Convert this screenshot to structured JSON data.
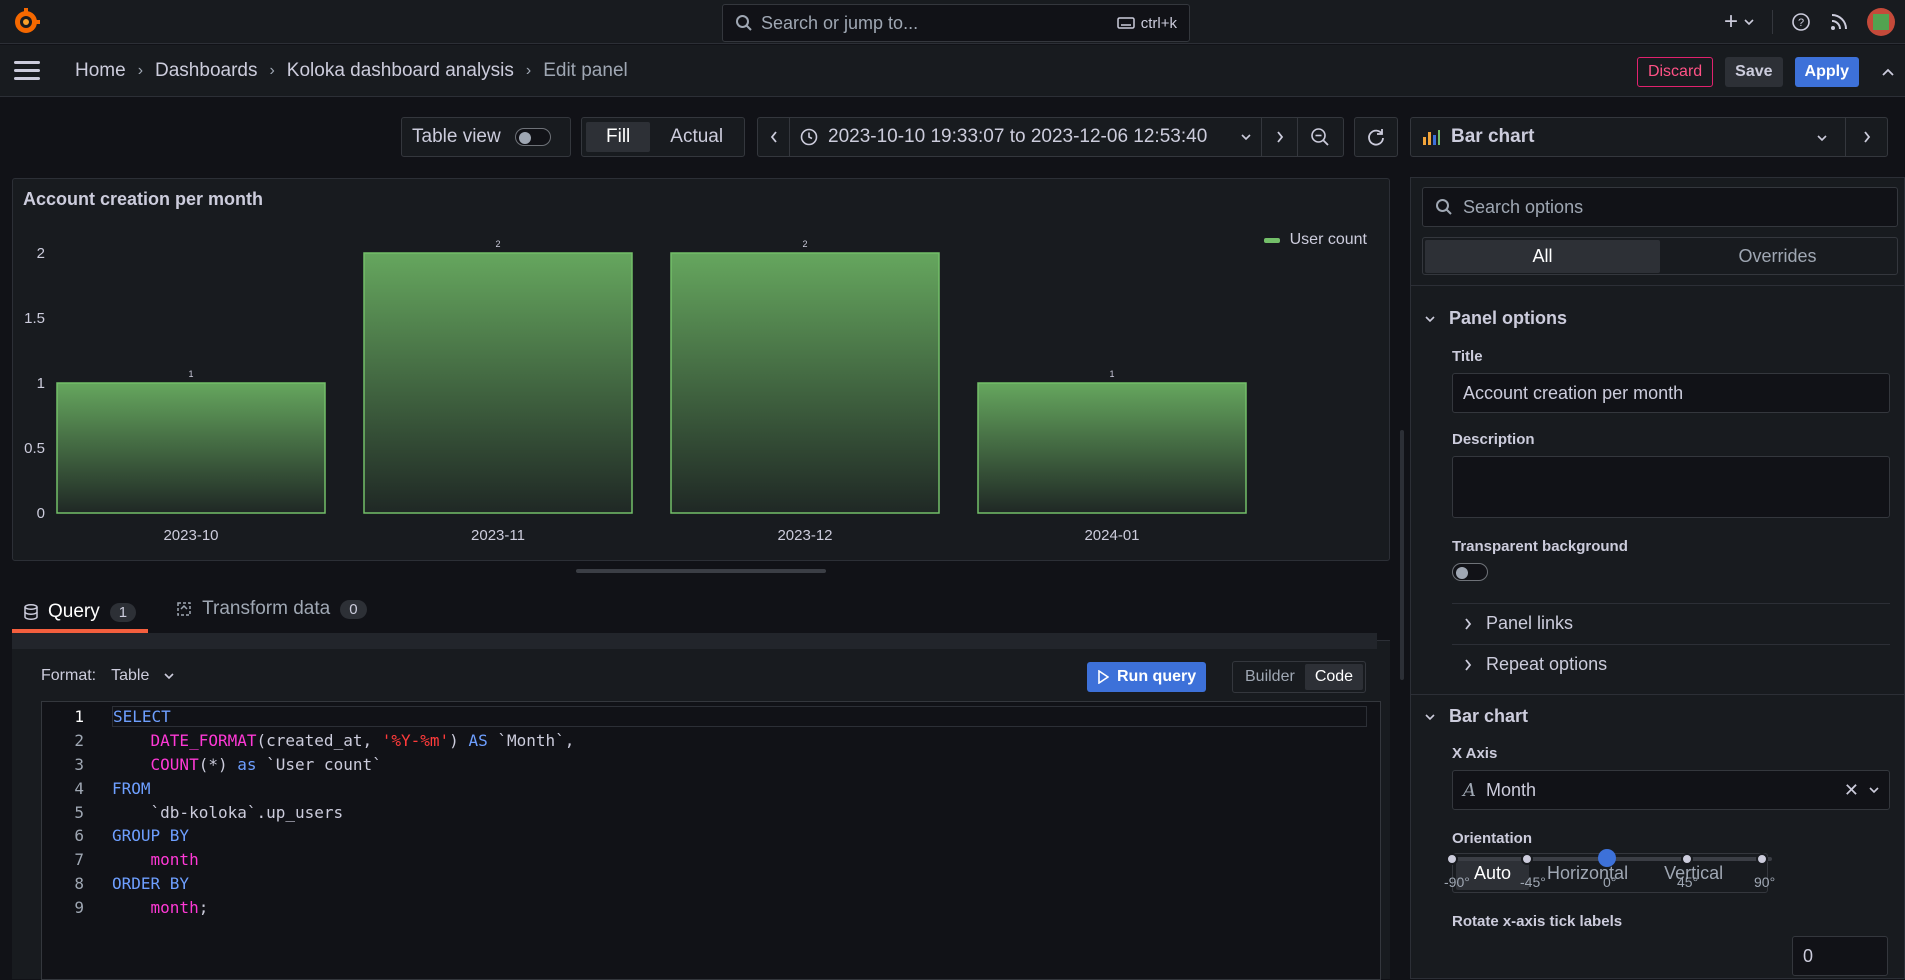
{
  "topbar": {
    "search_placeholder": "Search or jump to...",
    "search_shortcut": "ctrl+k",
    "plus_label": "+"
  },
  "breadcrumb": [
    "Home",
    "Dashboards",
    "Koloka dashboard analysis",
    "Edit panel"
  ],
  "actions": {
    "discard": "Discard",
    "save": "Save",
    "apply": "Apply"
  },
  "toolbar": {
    "table_view": "Table view",
    "fill": "Fill",
    "actual": "Actual",
    "time_range": "2023-10-10 19:33:07 to 2023-12-06 12:53:40"
  },
  "panel": {
    "title": "Account creation per month",
    "legend": "User count",
    "series_color": "#73bf69"
  },
  "chart_data": {
    "type": "bar",
    "categories": [
      "2023-10",
      "2023-11",
      "2023-12",
      "2024-01"
    ],
    "series": [
      {
        "name": "User count",
        "values": [
          1,
          2,
          2,
          1
        ]
      }
    ],
    "yticks": [
      "0",
      "0.5",
      "1",
      "1.5",
      "2"
    ],
    "ylim": [
      0,
      2
    ],
    "title": "Account creation per month",
    "legend_position": "top-right"
  },
  "query_tabs": [
    {
      "label": "Query",
      "count": "1"
    },
    {
      "label": "Transform data",
      "count": "0"
    }
  ],
  "query": {
    "format_label": "Format:",
    "format_value": "Table",
    "run_label": "Run query",
    "mode_builder": "Builder",
    "mode_code": "Code"
  },
  "code_lines": [
    {
      "n": "1",
      "html": "<span class=\"kw\">SELECT</span>"
    },
    {
      "n": "2",
      "html": "    <span class=\"fn\">DATE_FORMAT</span>(created_at, <span class=\"str\">'%Y-%m'</span>) <span class=\"kw\">AS</span> `Month`,"
    },
    {
      "n": "3",
      "html": "    <span class=\"fn\">COUNT</span>(*) <span class=\"kw\">as</span> `User count`"
    },
    {
      "n": "4",
      "html": "<span class=\"kw\">FROM</span>"
    },
    {
      "n": "5",
      "html": "    `db-koloka`.up_users"
    },
    {
      "n": "6",
      "html": "<span class=\"kw\">GROUP BY</span>"
    },
    {
      "n": "7",
      "html": "    <span class=\"fn\">month</span>"
    },
    {
      "n": "8",
      "html": "<span class=\"kw\">ORDER BY</span>"
    },
    {
      "n": "9",
      "html": "    <span class=\"fn\">month</span>;"
    }
  ],
  "options": {
    "viz_name": "Bar chart",
    "search_placeholder": "Search options",
    "tab_all": "All",
    "tab_overrides": "Overrides",
    "panel_options": "Panel options",
    "title_label": "Title",
    "title_value": "Account creation per month",
    "description_label": "Description",
    "transparent_label": "Transparent background",
    "panel_links": "Panel links",
    "repeat_options": "Repeat options",
    "bar_chart": "Bar chart",
    "x_axis_label": "X Axis",
    "x_axis_value": "Month",
    "orientation_label": "Orientation",
    "orient_auto": "Auto",
    "orient_horizontal": "Horizontal",
    "orient_vertical": "Vertical",
    "rotate_label": "Rotate x-axis tick labels",
    "rotate_value": "0",
    "rotate_ticks": [
      "-90°",
      "-45°",
      "0°",
      "45°",
      "90°"
    ]
  }
}
